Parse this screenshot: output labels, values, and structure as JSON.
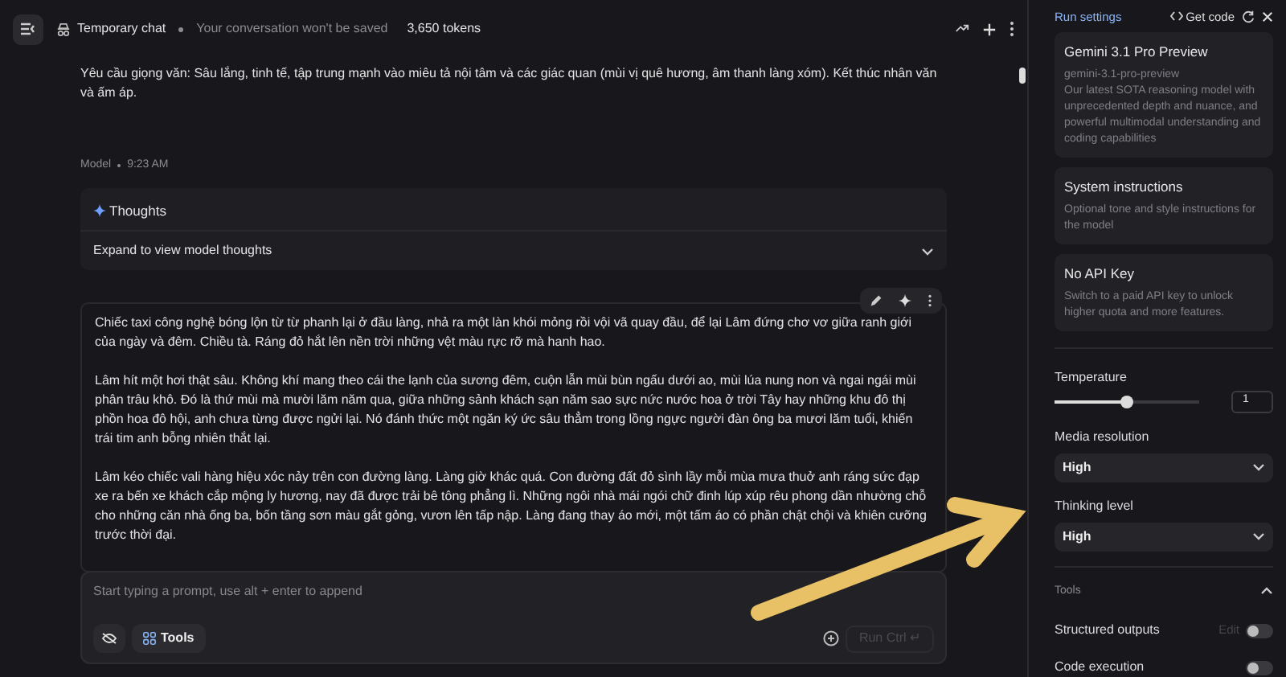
{
  "header": {
    "title": "Temporary chat",
    "subtitle": "Your conversation won't be saved",
    "tokens": "3,650 tokens"
  },
  "user_message": {
    "text": "Yêu cầu giọng văn: Sâu lắng, tinh tế, tập trung mạnh vào miêu tả nội tâm và các giác quan (mùi vị quê hương, âm thanh làng xóm). Kết thúc nhân văn và ấm áp."
  },
  "model_message": {
    "author": "Model",
    "time": "9:23 AM",
    "thoughts": {
      "title": "Thoughts",
      "expand_label": "Expand to view model thoughts",
      "expanded": false
    },
    "paragraphs": [
      "Chiếc taxi công nghệ bóng lộn từ từ phanh lại ở đầu làng, nhả ra một làn khói mỏng rồi vội vã quay đầu, để lại Lâm đứng chơ vơ giữa ranh giới của ngày và đêm. Chiều tà. Ráng đỏ hắt lên nền trời những vệt màu rực rỡ mà hanh hao.",
      "Lâm hít một hơi thật sâu. Không khí mang theo cái the lạnh của sương đêm, cuộn lẫn mùi bùn ngấu dưới ao, mùi lúa nung non và ngai ngái mùi phân trâu khô. Đó là thứ mùi mà mười lăm năm qua, giữa những sảnh khách sạn năm sao sực nức nước hoa ở trời Tây hay những khu đô thị phồn hoa đô hội, anh chưa từng được ngửi lại. Nó đánh thức một ngăn ký ức sâu thẳm trong lồng ngực người đàn ông ba mươi lăm tuổi, khiến trái tim anh bỗng nhiên thắt lại.",
      "Lâm kéo chiếc vali hàng hiệu xóc nảy trên con đường làng. Làng giờ khác quá. Con đường đất đỏ sình lầy mỗi mùa mưa thuở anh ráng sức đạp xe ra bến xe khách cắp mộng ly hương, nay đã được trải bê tông phẳng lì. Những ngôi nhà mái ngói chữ đinh lúp xúp rêu phong dần nhường chỗ cho những căn nhà ống ba, bốn tầng sơn màu gắt gỏng, vươn lên tấp nập. Làng đang thay áo mới, một tấm áo có phần chật chội và khiên cưỡng trước thời đại."
    ]
  },
  "prompt": {
    "placeholder": "Start typing a prompt, use alt + enter to append",
    "tools_button": "Tools",
    "run_button": "Run Ctrl ↵",
    "run_disabled": true
  },
  "run_settings": {
    "title": "Run settings",
    "get_code": "Get code",
    "cards": [
      {
        "title": "Gemini 3.1 Pro Preview",
        "subtitle": "gemini-3.1-pro-preview",
        "description": "Our latest SOTA reasoning model with unprecedented depth and nuance, and powerful multimodal understanding and coding capabilities"
      },
      {
        "title": "System instructions",
        "description": "Optional tone and style instructions for the model"
      },
      {
        "title": "No API Key",
        "description": "Switch to a paid API key to unlock higher quota and more features."
      }
    ],
    "temperature": {
      "label": "Temperature",
      "level": 0.5,
      "value": "1"
    },
    "selects": [
      {
        "label": "Media resolution",
        "value": "High"
      },
      {
        "label": "Thinking level",
        "value": "High"
      }
    ],
    "tools": {
      "label": "Tools",
      "expanded": true,
      "items": [
        {
          "label": "Structured outputs",
          "edit": "Edit",
          "on": false
        },
        {
          "label": "Code execution",
          "on": false
        }
      ]
    }
  }
}
